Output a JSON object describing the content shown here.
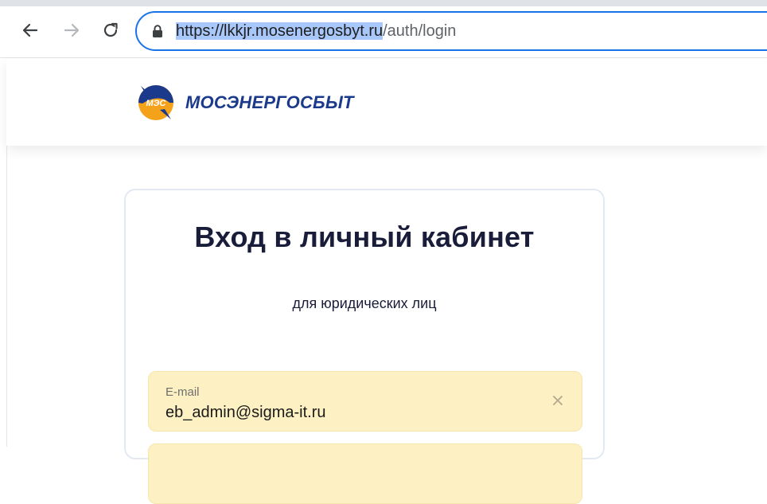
{
  "browser": {
    "url_host": "https://lkkjr.mosenergosbyt.ru",
    "url_path": "/auth/login",
    "icons": {
      "back": "arrow-left-icon",
      "forward": "arrow-right-icon",
      "reload": "reload-icon",
      "lock": "lock-icon"
    },
    "colors": {
      "omnibox_border": "#1a73e8",
      "selection": "#a8c7fa"
    }
  },
  "site": {
    "logo_mark_text": "МЭС",
    "logo_text": "МОСЭНЕРГОСБЫТ",
    "colors": {
      "brand_blue": "#1b3a8c",
      "brand_orange": "#f5a21b"
    }
  },
  "login": {
    "title": "Вход в личный кабинет",
    "subtitle": "для юридических лиц",
    "email": {
      "label": "E-mail",
      "value": "eb_admin@sigma-it.ru",
      "clear_icon": "close-icon"
    },
    "colors": {
      "field_bg": "#fdf0c2"
    }
  }
}
